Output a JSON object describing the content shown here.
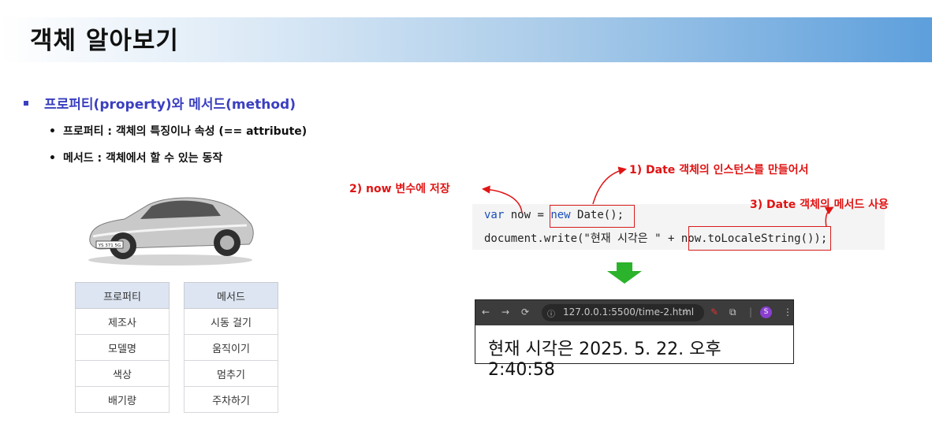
{
  "slide": {
    "title": "객체 알아보기"
  },
  "bullets": {
    "main": "프로퍼티(property)와 메서드(method)",
    "sub1": "프로퍼티 : 객체의 특징이나 속성 (== attribute)",
    "sub2": "메서드 : 객체에서 할 수 있는 동작"
  },
  "tables": {
    "property": {
      "header": "프로퍼티",
      "rows": [
        "제조사",
        "모델명",
        "색상",
        "배기량"
      ]
    },
    "method": {
      "header": "메서드",
      "rows": [
        "시동 걸기",
        "움직이기",
        "멈추기",
        "주차하기"
      ]
    }
  },
  "car": {
    "plate": "YS 371 5G"
  },
  "code": {
    "line1_var": "var",
    "line1_mid": " now = ",
    "line1_new": "new",
    "line1_end": " Date();",
    "line2_start": "document.write(\"현재 시각은 \" + ",
    "line2_call": "now.toLocaleString()",
    "line2_end": ");"
  },
  "annotations": {
    "a1": "1) Date 객체의 인스턴스를 만들어서",
    "a2": "2) now 변수에 저장",
    "a3": "3) Date 객체의 메서드 사용"
  },
  "browser": {
    "url": "127.0.0.1:5500/time-2.html",
    "profile_initial": "S",
    "output": "현재 시각은 2025. 5. 22. 오후 2:40:58"
  },
  "colors": {
    "accent": "#3a3fc0",
    "annotation": "#e01414",
    "arrow_down": "#2bb32b"
  }
}
